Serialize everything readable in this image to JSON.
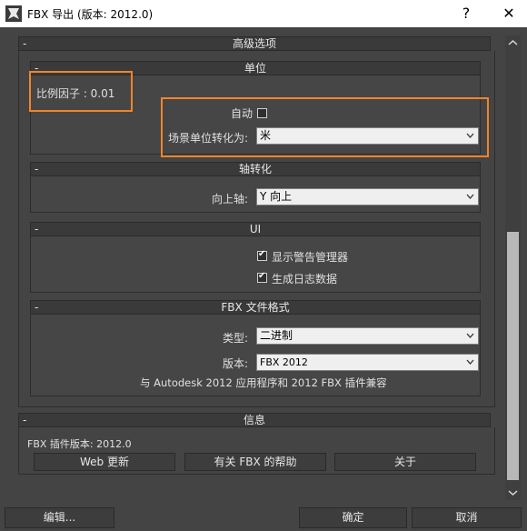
{
  "window": {
    "title": "FBX 导出 (版本: 2012.0)",
    "help_glyph": "?",
    "close_glyph": "✕",
    "app_icon": "3dsmax-logo-icon"
  },
  "advanced": {
    "header": "高级选项"
  },
  "units": {
    "header": "单位",
    "scale_factor_label": "比例因子 : 0.01",
    "automatic_label": "自动",
    "automatic_checked": false,
    "scene_units_label": "场景单位转化为:",
    "scene_units_value": "米"
  },
  "axis": {
    "header": "轴转化",
    "up_axis_label": "向上轴:",
    "up_axis_value": "Y 向上"
  },
  "ui": {
    "header": "UI",
    "show_warning_label": "显示警告管理器",
    "show_warning_checked": true,
    "generate_log_label": "生成日志数据",
    "generate_log_checked": true
  },
  "fbx_format": {
    "header": "FBX 文件格式",
    "type_label": "类型:",
    "type_value": "二进制",
    "version_label": "版本:",
    "version_value": "FBX 2012",
    "compat_note": "与 Autodesk 2012 应用程序和 2012 FBX 插件兼容"
  },
  "info": {
    "header": "信息",
    "plugin_version": "FBX 插件版本: 2012.0",
    "web_update": "Web 更新",
    "help": "有关 FBX 的帮助",
    "about": "关于"
  },
  "footer": {
    "edit": "编辑...",
    "ok": "确定",
    "cancel": "取消"
  },
  "highlight_color": "#f0842a",
  "minus_glyph": "-"
}
